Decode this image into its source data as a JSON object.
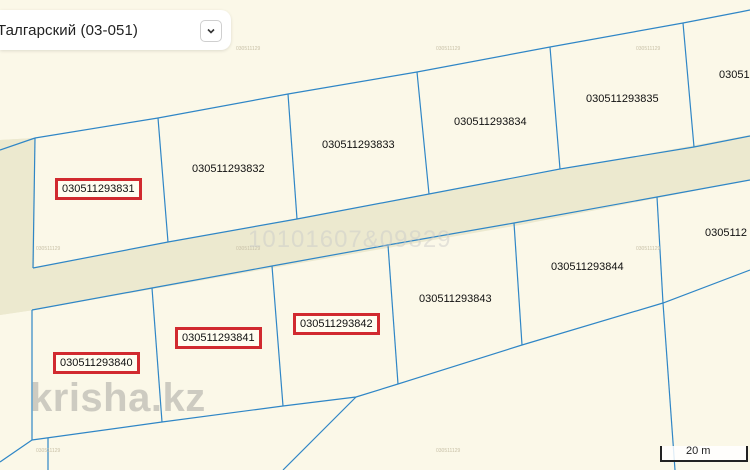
{
  "district": {
    "label": "Талгарский (03-051)"
  },
  "parcels": [
    {
      "id": "030511293831",
      "highlighted": true
    },
    {
      "id": "030511293832",
      "highlighted": false
    },
    {
      "id": "030511293833",
      "highlighted": false
    },
    {
      "id": "030511293834",
      "highlighted": false
    },
    {
      "id": "030511293835",
      "highlighted": false
    },
    {
      "id": "03051",
      "highlighted": false
    },
    {
      "id": "030511293840",
      "highlighted": true
    },
    {
      "id": "030511293841",
      "highlighted": true
    },
    {
      "id": "030511293842",
      "highlighted": true
    },
    {
      "id": "030511293843",
      "highlighted": false
    },
    {
      "id": "030511293844",
      "highlighted": false
    },
    {
      "id": "0305112",
      "highlighted": false
    }
  ],
  "overlay": {
    "road_id": "10101607&09829",
    "watermark": "krisha.kz",
    "tiny_tag": "030511129"
  },
  "scale_bar": {
    "label": "20 m"
  },
  "colors": {
    "background": "#fbf8e8",
    "road": "#ece9cf",
    "boundary": "#2f86c6",
    "highlight": "#d12a2f"
  }
}
